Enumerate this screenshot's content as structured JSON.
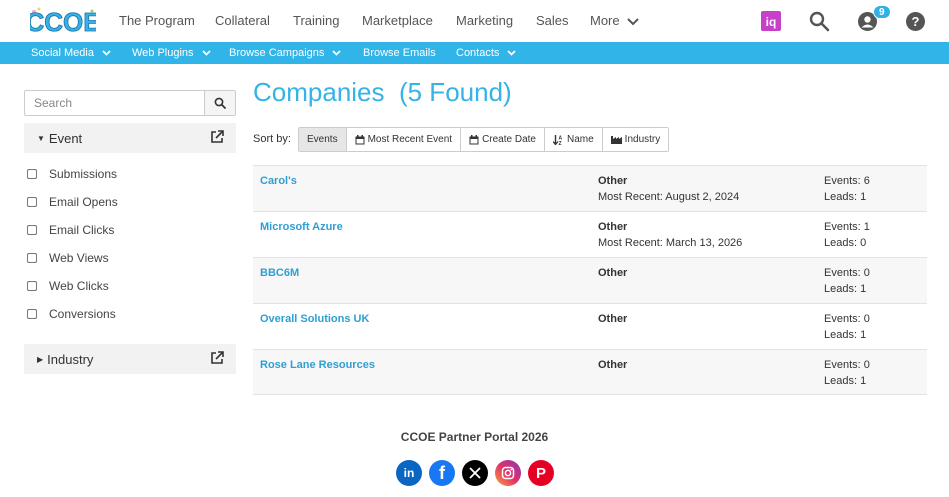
{
  "brand": {
    "logo_text": "CCOE"
  },
  "topnav": {
    "items": [
      "The Program",
      "Collateral",
      "Training",
      "Marketplace",
      "Marketing",
      "Sales",
      "More"
    ],
    "notification_count": "9"
  },
  "subnav": {
    "items": [
      "Social Media",
      "Web Plugins",
      "Browse Campaigns",
      "Browse Emails",
      "Contacts"
    ]
  },
  "sidebar": {
    "search_placeholder": "Search",
    "event_heading": "Event",
    "event_options": [
      "Submissions",
      "Email Opens",
      "Email Clicks",
      "Web Views",
      "Web Clicks",
      "Conversions"
    ],
    "industry_heading": "Industry"
  },
  "main": {
    "title": "Companies",
    "found": "(5 Found)",
    "sort_label": "Sort by:",
    "sort_options": [
      "Events",
      "Most Recent Event",
      "Create Date",
      "Name",
      "Industry"
    ],
    "companies": [
      {
        "name": "Carol's",
        "type": "Other",
        "recent": "Most Recent: August 2, 2024",
        "events": "Events: 6",
        "leads": "Leads: 1"
      },
      {
        "name": "Microsoft Azure",
        "type": "Other",
        "recent": "Most Recent: March 13, 2026",
        "events": "Events: 1",
        "leads": "Leads: 0"
      },
      {
        "name": "BBC6M",
        "type": "Other",
        "recent": "",
        "events": "Events: 0",
        "leads": "Leads: 1"
      },
      {
        "name": "Overall Solutions UK",
        "type": "Other",
        "recent": "",
        "events": "Events: 0",
        "leads": "Leads: 1"
      },
      {
        "name": "Rose Lane Resources",
        "type": "Other",
        "recent": "",
        "events": "Events: 0",
        "leads": "Leads: 1"
      }
    ]
  },
  "footer": {
    "text": "CCOE Partner Portal 2026"
  },
  "colors": {
    "accent": "#31b4e8",
    "link": "#2f9fd3",
    "title": "#35b3e6"
  },
  "icons": [
    "search-icon",
    "user-icon",
    "help-icon",
    "iq-icon",
    "external-link-icon",
    "linkedin-icon",
    "facebook-icon",
    "x-icon",
    "instagram-icon",
    "pinterest-icon"
  ]
}
